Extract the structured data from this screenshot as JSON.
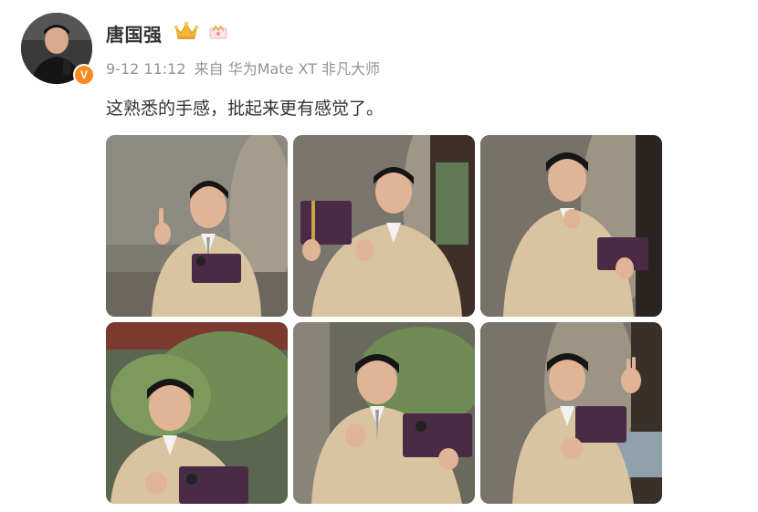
{
  "post": {
    "author": "唐国强",
    "verified": "V",
    "timestamp": "9-12 11:12",
    "source": "来自 华为Mate XT 非凡大师",
    "text": "这熟悉的手感，批起来更有感觉了。"
  },
  "icons": {
    "avatar": "avatar-photo",
    "verified": "verified-badge-icon",
    "crown": "crown-icon",
    "member": "member-badge-icon"
  },
  "colors": {
    "verified_badge": "#f78b1e",
    "crown": "#f5b53a",
    "meta_text": "#939393",
    "jacket": "#d9c3a0",
    "phone": "#4a2a45"
  },
  "images": [
    {
      "alt": "photo-1"
    },
    {
      "alt": "photo-2"
    },
    {
      "alt": "photo-3"
    },
    {
      "alt": "photo-4"
    },
    {
      "alt": "photo-5"
    },
    {
      "alt": "photo-6"
    }
  ]
}
